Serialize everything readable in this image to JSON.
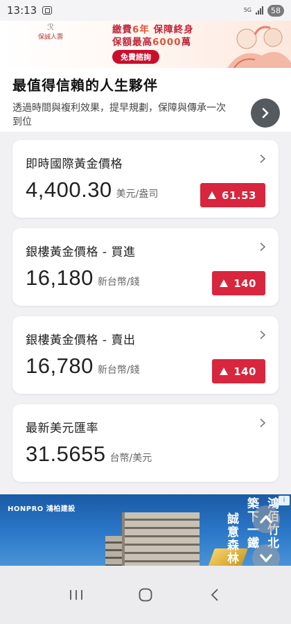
{
  "status_bar": {
    "time": "13:13",
    "network_type": "5G",
    "battery": "58",
    "icons": [
      "screenshot-icon",
      "signal-icon",
      "battery-icon"
    ]
  },
  "ad_top": {
    "brand": "保誠人壽",
    "promo_line1_a": "繳費",
    "promo_line1_b": "6年",
    "promo_line1_c": " 保障終身",
    "promo_line2_a": "保額最高",
    "promo_line2_b": "6000",
    "promo_line2_c": "萬",
    "cta": "免費諮詢",
    "headline": "最值得信賴的人生夥伴",
    "description": "透過時間與複利效果，提早規劃，保障與傳承一次到位"
  },
  "cards": [
    {
      "title": "即時國際黃金價格",
      "value": "4,400.30",
      "unit": "美元/盎司",
      "change": "61.53"
    },
    {
      "title": "銀樓黃金價格 - 買進",
      "value": "16,180",
      "unit": "新台幣/錢",
      "change": "140"
    },
    {
      "title": "銀樓黃金價格 - 賣出",
      "value": "16,780",
      "unit": "新台幣/錢",
      "change": "140"
    },
    {
      "title": "最新美元匯率",
      "value": "31.5655",
      "unit": "台幣/美元"
    }
  ],
  "ad_bottom": {
    "brand": "HONPRO 鴻柏建設",
    "vtext1": "鴻佰竹北",
    "vtext2": "築下一鐵",
    "vtext3": "誠意森林",
    "info_icon": "info-icon"
  },
  "colors": {
    "up_badge": "#d7263d",
    "background": "#f1f1f3",
    "card": "#ffffff"
  }
}
